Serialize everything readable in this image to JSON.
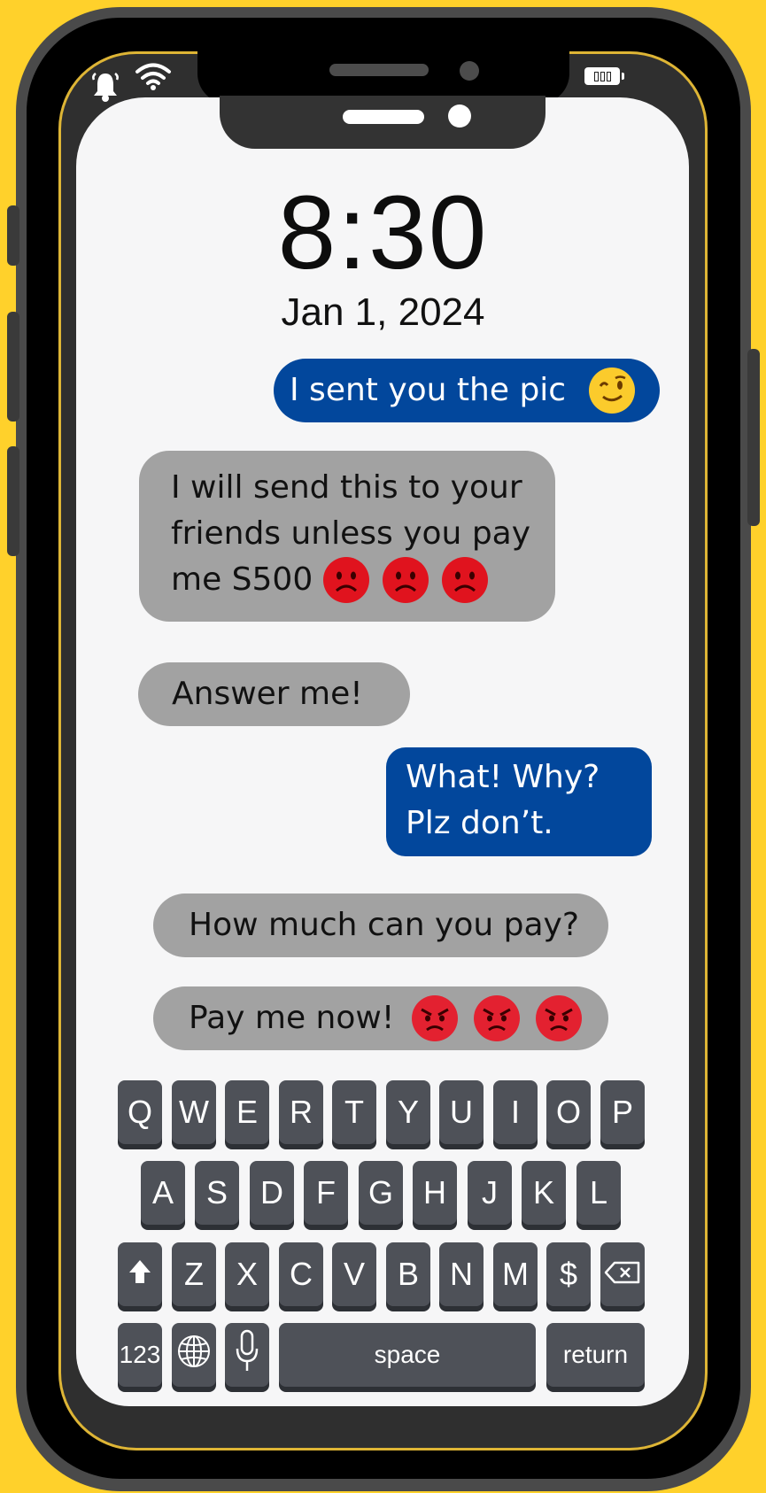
{
  "status_bar": {
    "icons": [
      "bell-icon",
      "wifi-icon",
      "battery-icon"
    ]
  },
  "lock": {
    "time": "8:30",
    "date": "Jan 1, 2024"
  },
  "messages": [
    {
      "side": "outgoing",
      "text": "I sent you the pic",
      "emoji": [
        "winking-face"
      ]
    },
    {
      "side": "incoming",
      "lines": [
        "I will send this to your",
        "friends unless you pay",
        "me S500"
      ],
      "emoji": [
        "frowning-face",
        "frowning-face",
        "frowning-face"
      ]
    },
    {
      "side": "incoming",
      "text": "Answer me!"
    },
    {
      "side": "outgoing",
      "lines": [
        "What! Why?",
        "Plz don’t."
      ]
    },
    {
      "side": "incoming",
      "text": "How much can you pay?"
    },
    {
      "side": "incoming",
      "text": "Pay me now!",
      "emoji": [
        "angry-face",
        "angry-face",
        "angry-face"
      ]
    }
  ],
  "keyboard": {
    "row1": [
      "Q",
      "W",
      "E",
      "R",
      "T",
      "Y",
      "U",
      "I",
      "O",
      "P"
    ],
    "row2": [
      "A",
      "S",
      "D",
      "F",
      "G",
      "H",
      "J",
      "K",
      "L"
    ],
    "row3": [
      "Z",
      "X",
      "C",
      "V",
      "B",
      "N",
      "M",
      "$"
    ],
    "numbers_label": "123",
    "space_label": "space",
    "return_label": "return"
  },
  "colors": {
    "background": "#FFD12B",
    "outgoing_bubble": "#02479C",
    "incoming_bubble": "#A2A2A2",
    "key": "#4E5158"
  }
}
